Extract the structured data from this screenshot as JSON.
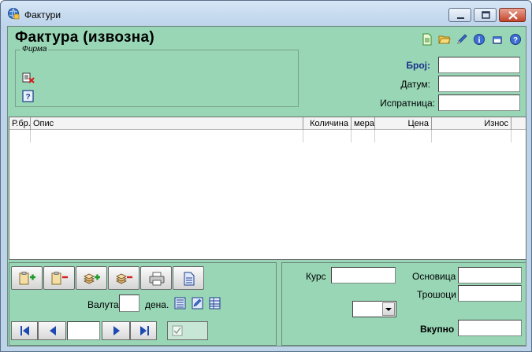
{
  "window": {
    "title": "Фактури"
  },
  "header": {
    "page_title": "Фактура (извозна)"
  },
  "firma": {
    "legend": "Фирма"
  },
  "fields": {
    "broj_label": "Број:",
    "datum_label": "Датум:",
    "ispratnica_label": "Испратница:",
    "broj_value": "",
    "datum_value": "",
    "ispratnica_value": ""
  },
  "grid": {
    "columns": [
      "Р.бр.",
      "Опис",
      "Количина",
      "мера",
      "Цена",
      "Износ"
    ]
  },
  "bottom_left": {
    "currency_label": "Валута",
    "currency_value": "",
    "days_label": "дена."
  },
  "bottom_right": {
    "kurs_label": "Курс",
    "osnovica_label": "Основица",
    "troshoci_label": "Трошоци",
    "vkupno_label": "Вкупно",
    "kurs_value": "",
    "osnovica_value": "",
    "troshoci_value": "",
    "vkupno_value": "",
    "currency_select_value": ""
  },
  "colors": {
    "panel": "#98d6b6",
    "accent_blue": "#1a2f8a"
  }
}
